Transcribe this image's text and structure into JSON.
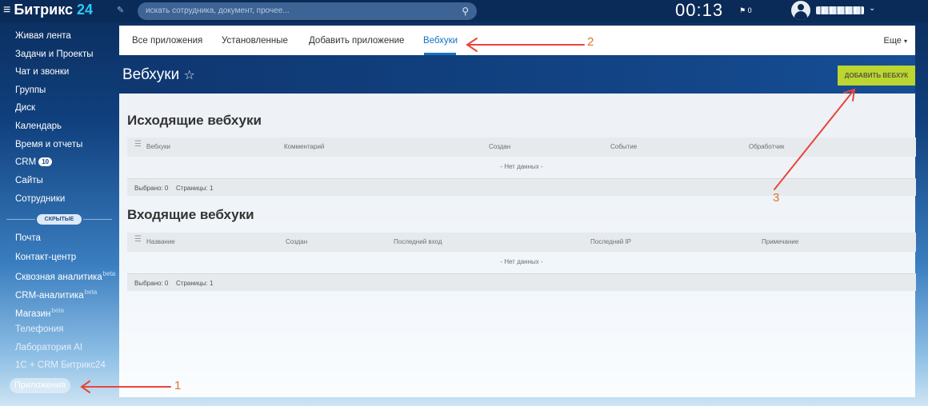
{
  "header": {
    "brand": "Битрикс",
    "brand_number": "24",
    "search_placeholder": "искать сотрудника, документ, прочее...",
    "clock": "00:13",
    "clock_flag": "0"
  },
  "sidebar": {
    "items": [
      {
        "label": "Живая лента"
      },
      {
        "label": "Задачи и Проекты"
      },
      {
        "label": "Чат и звонки"
      },
      {
        "label": "Группы"
      },
      {
        "label": "Диск"
      },
      {
        "label": "Календарь"
      },
      {
        "label": "Время и отчеты"
      },
      {
        "label": "CRM",
        "badge": "10"
      },
      {
        "label": "Сайты"
      },
      {
        "label": "Сотрудники"
      }
    ],
    "hidden_label": "СКРЫТЫЕ",
    "hidden_items": [
      {
        "label": "Почта"
      },
      {
        "label": "Контакт-центр"
      },
      {
        "label": "Сквозная аналитика",
        "sup": "beta"
      },
      {
        "label": "CRM-аналитика",
        "sup": "beta"
      },
      {
        "label": "Магазин",
        "sup": "beta"
      },
      {
        "label": "Телефония"
      },
      {
        "label": "Лаборатория AI"
      },
      {
        "label": "1С + CRM Битрикс24"
      }
    ],
    "apps_label": "Приложения"
  },
  "tabs": {
    "items": [
      "Все приложения",
      "Установленные",
      "Добавить приложение",
      "Вебхуки"
    ],
    "active": "Вебхуки",
    "more": "Еще"
  },
  "title_bar": {
    "title": "Вебхуки",
    "add_button": "ДОБАВИТЬ ВЕБХУК"
  },
  "outgoing": {
    "title": "Исходящие вебхуки",
    "columns": [
      "Вебхуки",
      "Комментарий",
      "Создан",
      "Событие",
      "Обработчик"
    ],
    "empty": "- Нет данных -",
    "selected": "Выбрано: 0",
    "pages": "Страницы: 1"
  },
  "incoming": {
    "title": "Входящие вебхуки",
    "columns": [
      "Название",
      "Создан",
      "Последний вход",
      "Последний IP",
      "Примечание"
    ],
    "empty": "- Нет данных -",
    "selected": "Выбрано: 0",
    "pages": "Страницы: 1"
  },
  "annotations": {
    "labels": [
      "1",
      "2",
      "3"
    ],
    "color": "#e8453c",
    "number_color": "#e0732c"
  }
}
